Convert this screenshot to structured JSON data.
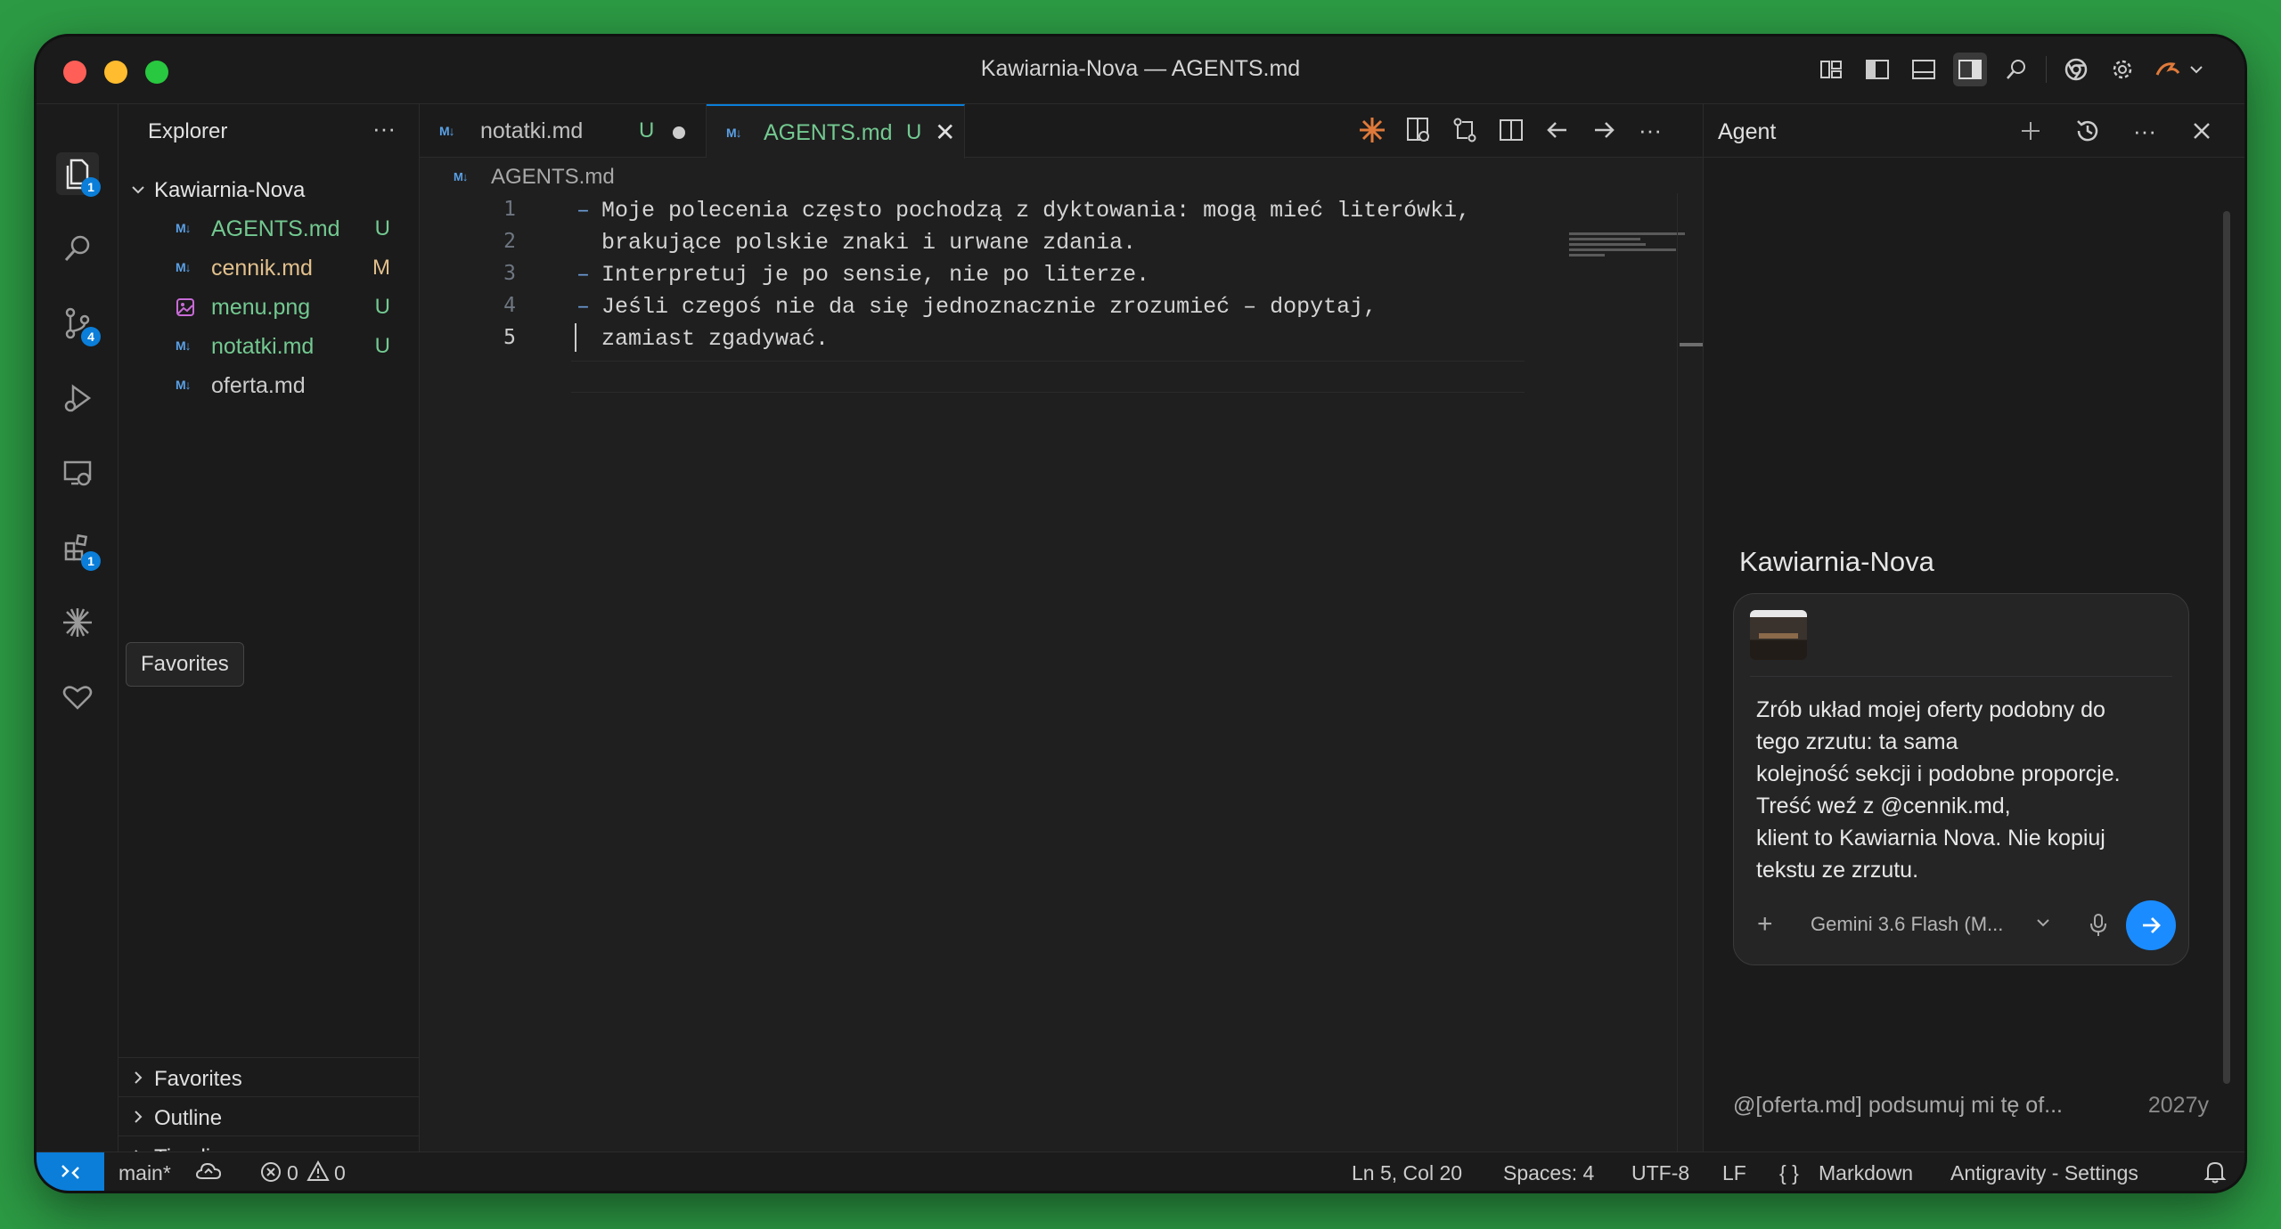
{
  "window": {
    "title": "Kawiarnia-Nova — AGENTS.md"
  },
  "activity": {
    "explorer_badge": "1",
    "scm_badge": "4",
    "extensions_badge": "1",
    "tooltip": "Favorites"
  },
  "sidebar": {
    "title": "Explorer",
    "more": "···",
    "folder": "Kawiarnia-Nova",
    "files": [
      {
        "icon": "M↓",
        "name": "AGENTS.md",
        "status": "U",
        "kind": "md"
      },
      {
        "icon": "M↓",
        "name": "cennik.md",
        "status": "M",
        "kind": "md"
      },
      {
        "icon": "img",
        "name": "menu.png",
        "status": "U",
        "kind": "image"
      },
      {
        "icon": "M↓",
        "name": "notatki.md",
        "status": "U",
        "kind": "md"
      },
      {
        "icon": "M↓",
        "name": "oferta.md",
        "status": "",
        "kind": "md"
      }
    ],
    "sections": [
      "Favorites",
      "Outline",
      "Timeline"
    ]
  },
  "editor": {
    "tabs": [
      {
        "icon": "M↓",
        "name": "notatki.md",
        "status": "U",
        "dirty": true
      },
      {
        "icon": "M↓",
        "name": "AGENTS.md",
        "status": "U",
        "close": "✕"
      }
    ],
    "breadcrumb": {
      "icon": "M↓",
      "name": "AGENTS.md"
    },
    "lines": [
      {
        "n": "1",
        "bullet": "–",
        "text": "Moje polecenia często pochodzą z dyktowania: mogą mieć literówki,"
      },
      {
        "n": "2",
        "bullet": "",
        "text": "brakujące polskie znaki i urwane zdania."
      },
      {
        "n": "3",
        "bullet": "–",
        "text": "Interpretuj je po sensie, nie po literze."
      },
      {
        "n": "4",
        "bullet": "–",
        "text": "Jeśli czegoś nie da się jednoznacznie zrozumieć – dopytaj,"
      },
      {
        "n": "5",
        "bullet": "",
        "text": "zamiast zgadywać."
      }
    ]
  },
  "agent": {
    "title": "Agent",
    "workspace": "Kawiarnia-Nova",
    "prompt": "Zrób układ mojej oferty podobny do tego zrzutu: ta sama kolejność sekcji i podobne proporcje. Treść weź z @cennik.md, klient to Kawiarnia Nova. Nie kopiuj tekstu ze zrzutu.",
    "prompt_lines": [
      "Zrób układ mojej oferty podobny do",
      "tego zrzutu: ta sama",
      "kolejność sekcji i podobne proporcje.",
      "Treść weź z @cennik.md,",
      "klient to Kawiarnia Nova. Nie kopiuj",
      "tekstu ze zrzutu."
    ],
    "add": "+",
    "model": "Gemini 3.6 Flash (M...",
    "history": {
      "text": "@[oferta.md] podsumuj mi tę of...",
      "time": "2027y"
    }
  },
  "status": {
    "branch": "main*",
    "errors": "0",
    "warnings": "0",
    "position": "Ln 5, Col 20",
    "spaces": "Spaces: 4",
    "encoding": "UTF-8",
    "eol": "LF",
    "language": "Markdown",
    "language_icon": "{ }",
    "settings": "Antigravity - Settings"
  },
  "colors": {
    "accent": "#0a7ed9",
    "untracked": "#73c991",
    "modified": "#e2c08d",
    "background": "#2c9a44"
  }
}
